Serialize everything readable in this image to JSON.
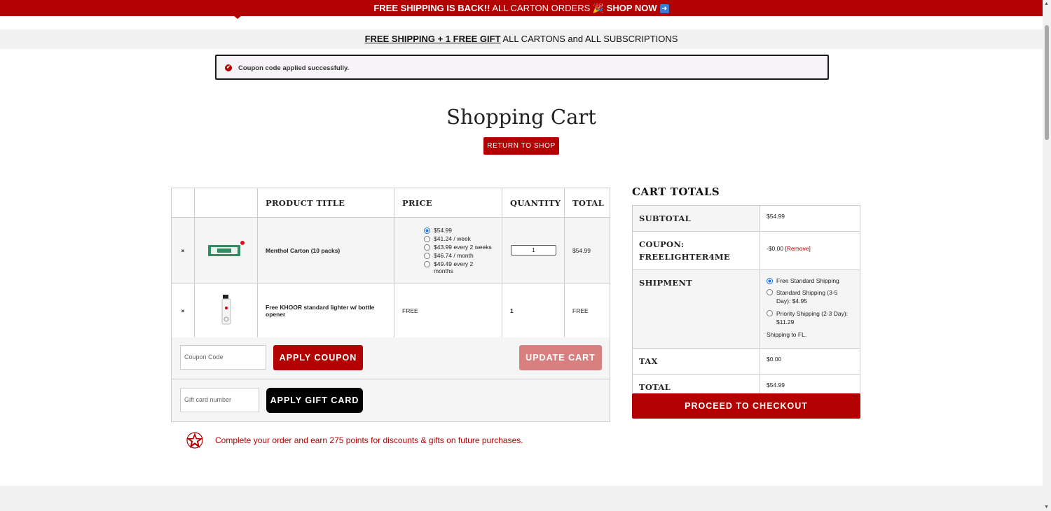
{
  "topbar": {
    "promo_bold": "FREE SHIPPING IS BACK!!",
    "promo_text": " ALL CARTON ORDERS 🎉 ",
    "shop_now": "SHOP NOW",
    "arrow_icon": "right-arrow-icon"
  },
  "subbar": {
    "bold": "FREE SHIPPING + 1 FREE GIFT",
    "text": " ALL CARTONS and ALL SUBSCRIPTIONS"
  },
  "notice": {
    "message": "Coupon code applied successfully."
  },
  "page": {
    "title": "Shopping Cart",
    "return_label": "RETURN TO SHOP"
  },
  "cart": {
    "headers": {
      "product": "PRODUCT TITLE",
      "price": "PRICE",
      "quantity": "QUANTITY",
      "total": "TOTAL"
    },
    "items": [
      {
        "remove": "×",
        "name": "Menthol Carton (10 packs)",
        "price_options": [
          "$54.99",
          "$41.24 / week",
          "$43.99 every 2 weeks",
          "$46.74 / month",
          "$49.49 every 2 months"
        ],
        "selected_option": 0,
        "quantity": "1",
        "total": "$54.99"
      },
      {
        "remove": "×",
        "name": "Free KHOOR standard lighter w/ bottle opener",
        "price": "FREE",
        "quantity": "1",
        "total": "FREE"
      }
    ],
    "coupon_placeholder": "Coupon Code",
    "apply_coupon": "APPLY COUPON",
    "update_cart": "UPDATE CART",
    "gift_placeholder": "Gift card number",
    "apply_gift": "APPLY GIFT CARD"
  },
  "earn": {
    "text": "Complete your order and earn 275 points for discounts & gifts on future purchases.",
    "icon": "star-icon"
  },
  "totals": {
    "title": "CART TOTALS",
    "subtotal_label": "SUBTOTAL",
    "subtotal": "$54.99",
    "coupon_label": "COUPON: FREELIGHTER4ME",
    "coupon_value": "-$0.00",
    "coupon_remove": "[Remove]",
    "shipment_label": "SHIPMENT",
    "shipping_options": [
      "Free Standard Shipping",
      "Standard Shipping (3-5 Day): $4.95",
      "Priority Shipping (2-3 Day): $11.29"
    ],
    "selected_shipping": 0,
    "shipping_to": "Shipping to FL.",
    "tax_label": "TAX",
    "tax": "$0.00",
    "total_label": "TOTAL",
    "total": "$54.99",
    "checkout": "PROCEED TO CHECKOUT"
  },
  "colors": {
    "brand_red": "#b30000",
    "update_disabled": "#d88080",
    "black_button": "#000000"
  }
}
